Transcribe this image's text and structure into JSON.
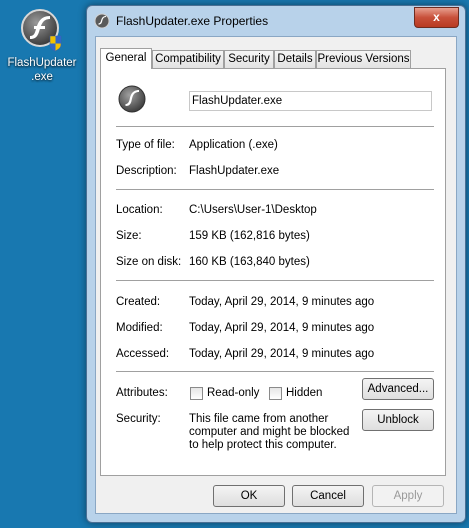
{
  "desktop": {
    "icon_label": "FlashUpdater\n.exe"
  },
  "window": {
    "title": "FlashUpdater.exe Properties",
    "close_glyph": "x"
  },
  "tabs": [
    "General",
    "Compatibility",
    "Security",
    "Details",
    "Previous Versions"
  ],
  "general": {
    "file_name": "FlashUpdater.exe",
    "type_label": "Type of file:",
    "type_value": "Application (.exe)",
    "desc_label": "Description:",
    "desc_value": "FlashUpdater.exe",
    "location_label": "Location:",
    "location_value": "C:\\Users\\User-1\\Desktop",
    "size_label": "Size:",
    "size_value": "159 KB (162,816 bytes)",
    "size_disk_label": "Size on disk:",
    "size_disk_value": "160 KB (163,840 bytes)",
    "created_label": "Created:",
    "created_value": "Today, April 29, 2014, 9 minutes ago",
    "modified_label": "Modified:",
    "modified_value": "Today, April 29, 2014, 9 minutes ago",
    "accessed_label": "Accessed:",
    "accessed_value": "Today, April 29, 2014, 9 minutes ago",
    "attributes_label": "Attributes:",
    "readonly_label": "Read-only",
    "hidden_label": "Hidden",
    "advanced_button": "Advanced...",
    "security_label": "Security:",
    "security_text": "This file came from another computer and might be blocked to help protect this computer.",
    "unblock_button": "Unblock"
  },
  "buttons": {
    "ok": "OK",
    "cancel": "Cancel",
    "apply": "Apply"
  }
}
